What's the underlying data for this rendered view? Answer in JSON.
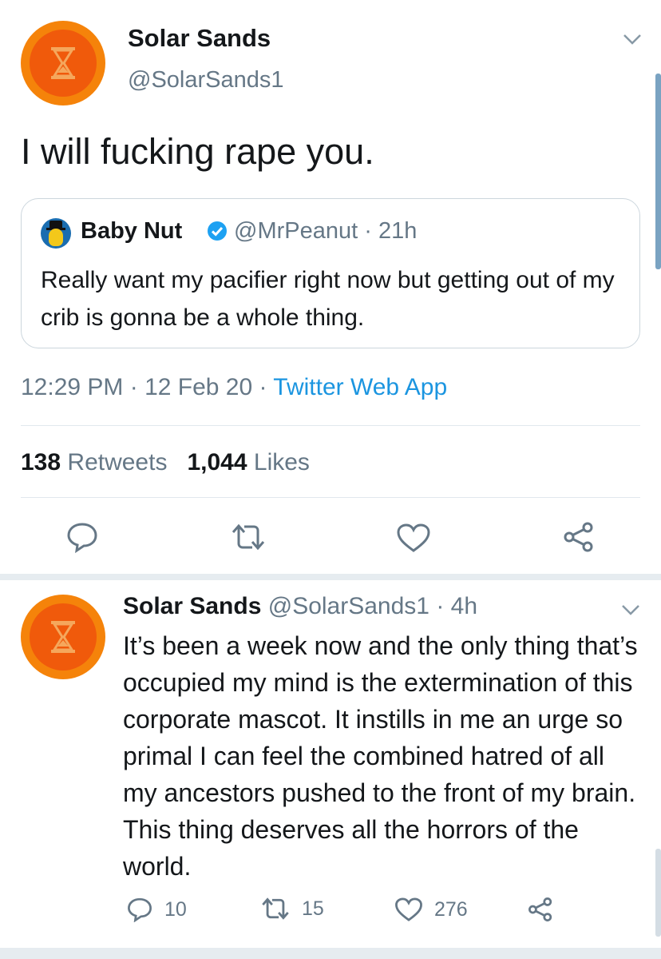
{
  "colors": {
    "avatar_outer": "#f5830a",
    "avatar_inner": "#f05a0b",
    "link_blue": "#1b95e0",
    "muted": "#657786",
    "text": "#14171a"
  },
  "main_tweet": {
    "display_name": "Solar Sands",
    "handle": "@SolarSands1",
    "text": "I will fucking rape you.",
    "avatar_icon": "hourglass-icon",
    "menu_icon": "chevron-down-icon",
    "quoted_tweet": {
      "display_name": "Baby Nut",
      "verified_icon": "verified-badge-icon",
      "meta": "@MrPeanut · 21h",
      "text": "Really want my pacifier right now but getting out of my crib is gonna be a whole thing."
    },
    "time": "12:29 PM · 12 Feb 20 · ",
    "source": "Twitter Web App",
    "retweet_count": "138",
    "retweet_label": " Retweets",
    "like_count": "1,044",
    "like_label": " Likes",
    "actions": [
      "reply-icon",
      "retweet-icon",
      "like-icon",
      "share-icon"
    ]
  },
  "reply_tweet": {
    "display_name": "Solar Sands",
    "meta": " @SolarSands1 · 4h",
    "text": "It’s been a week now and the only thing that’s occupied my mind is the extermination of this corporate mascot. It instills in me an urge so primal I can feel the combined hatred of all my ancestors pushed to the front of my brain. This thing deserves all the horrors of the world.",
    "reply_count": "10",
    "retweet_count": "15",
    "like_count": "276"
  }
}
